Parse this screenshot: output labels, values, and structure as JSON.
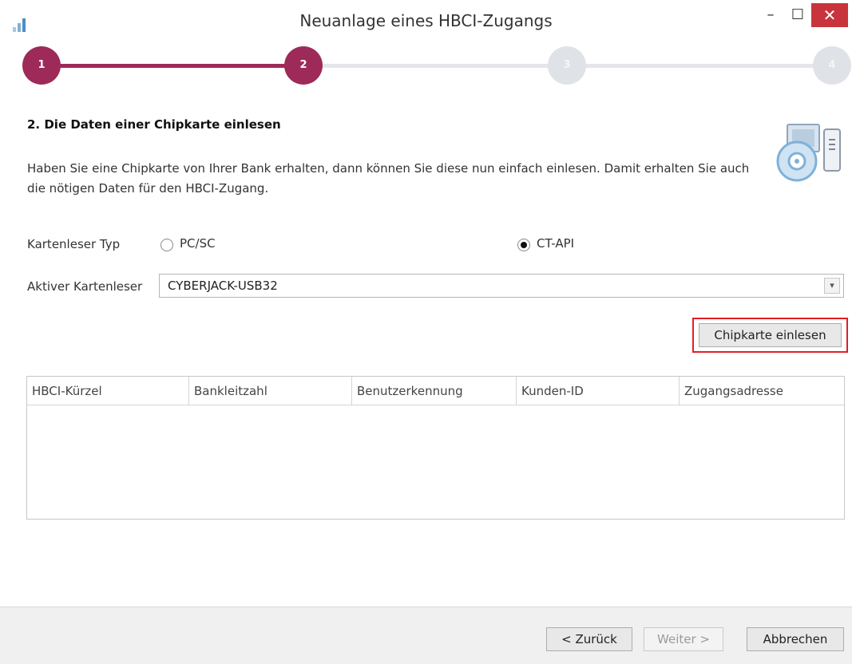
{
  "window": {
    "title": "Neuanlage eines HBCI-Zugangs",
    "minimize_glyph": "–",
    "maximize_glyph": "☐",
    "close_glyph": "✕",
    "icons": [
      "app-bars-icon",
      "minimize-icon",
      "maximize-icon",
      "close-icon"
    ]
  },
  "stepper": {
    "steps": [
      {
        "number": "1",
        "state": "done"
      },
      {
        "number": "2",
        "state": "active"
      },
      {
        "number": "3",
        "state": "pending"
      },
      {
        "number": "4",
        "state": "pending"
      }
    ],
    "accent_color": "#9d2a58",
    "inactive_color": "#dfe2e6"
  },
  "content": {
    "heading": "2. Die Daten einer Chipkarte einlesen",
    "description": "Haben Sie eine Chipkarte von Ihrer Bank erhalten, dann können Sie diese nun einfach einlesen. Damit erhalten Sie auch die nötigen Daten für den HBCI-Zugang.",
    "illustration_icon": "computer-disc-icon"
  },
  "form": {
    "reader_type_label": "Kartenleser Typ",
    "reader_type_options": [
      {
        "label": "PC/SC",
        "checked": false
      },
      {
        "label": "CT-API",
        "checked": true
      }
    ],
    "active_reader_label": "Aktiver Kartenleser",
    "active_reader_value": "CYBERJACK-USB32",
    "read_button_label": "Chipkarte einlesen",
    "highlight_color": "#e21e26"
  },
  "table": {
    "columns": [
      "HBCI-Kürzel",
      "Bankleitzahl",
      "Benutzerkennung",
      "Kunden-ID",
      "Zugangsadresse"
    ],
    "rows": []
  },
  "footer": {
    "back_label": "< Zurück",
    "next_label": "Weiter >",
    "cancel_label": "Abbrechen",
    "next_enabled": false
  }
}
